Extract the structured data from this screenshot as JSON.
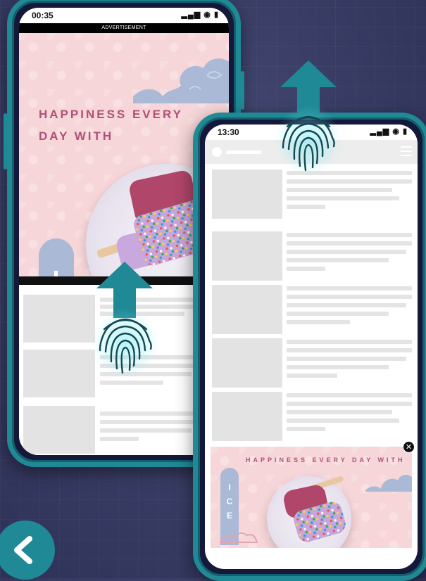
{
  "phone1": {
    "status_time": "00:35",
    "status_icons": "▂▄▆ ◉ ▮",
    "ad_label": "ADVERTISEMENT",
    "hero_headline": "HAPPINESS EVERY DAY WITH"
  },
  "phone2": {
    "status_time": "13:30",
    "status_icons": "▂▄▆ ◉ ▮",
    "bottom_ad_headline": "HAPPINESS EVERY DAY WITH",
    "bottom_ad_brand_letters": [
      "I",
      "C",
      "E"
    ],
    "close_symbol": "✕"
  },
  "icons": {
    "up_arrow": "up-arrow-icon",
    "fingerprint": "fingerprint-icon",
    "back": "chevron-left-icon",
    "close": "close-icon",
    "menu": "hamburger-menu-icon"
  },
  "colors": {
    "accent_teal": "#1f8996",
    "ad_pink": "#f6d6d8",
    "headline_rose": "#b0517a",
    "ice_blue": "#a9b9d6",
    "background_navy": "#3a3e66"
  }
}
